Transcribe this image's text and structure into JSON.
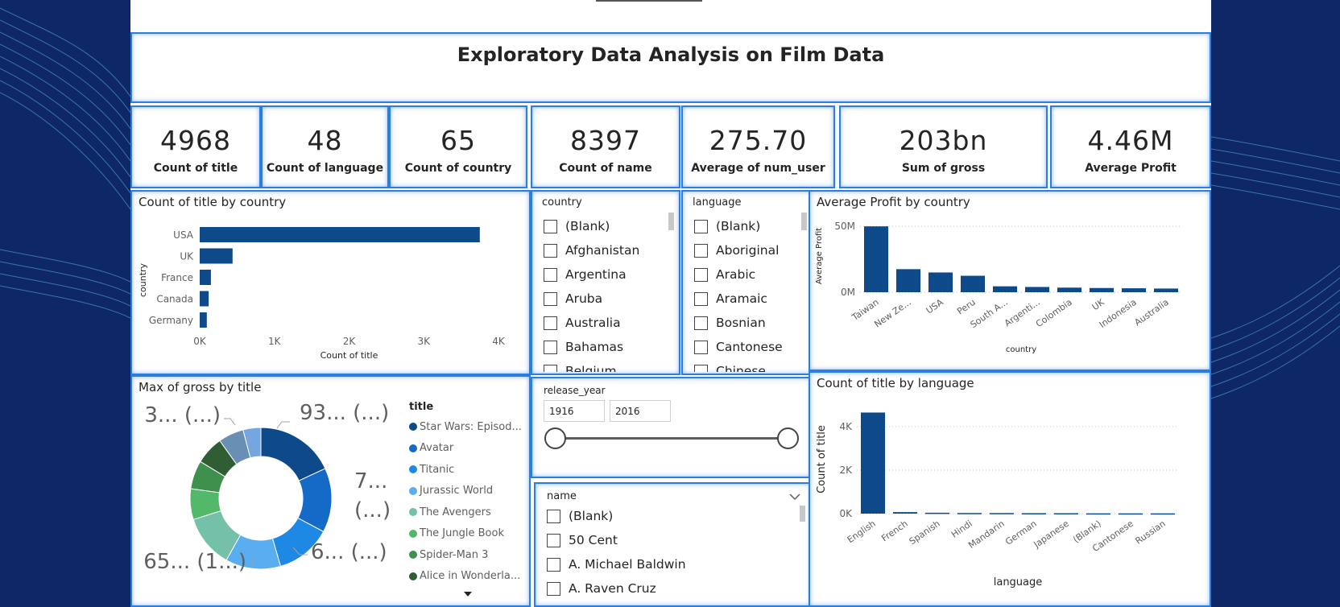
{
  "report": {
    "title": "Exploratory Data Analysis on Film Data"
  },
  "kpis": [
    {
      "value": "4968",
      "label": "Count of title"
    },
    {
      "value": "48",
      "label": "Count of language"
    },
    {
      "value": "65",
      "label": "Count of country"
    },
    {
      "value": "8397",
      "label": "Count of name"
    },
    {
      "value": "275.70",
      "label": "Average of num_user"
    },
    {
      "value": "203bn",
      "label": "Sum of gross"
    },
    {
      "value": "4.46M",
      "label": "Average Profit"
    }
  ],
  "slicers": {
    "country": {
      "header": "country",
      "items": [
        "(Blank)",
        "Afghanistan",
        "Argentina",
        "Aruba",
        "Australia",
        "Bahamas",
        "Belgium"
      ]
    },
    "language": {
      "header": "language",
      "items": [
        "(Blank)",
        "Aboriginal",
        "Arabic",
        "Aramaic",
        "Bosnian",
        "Cantonese",
        "Chinese"
      ]
    },
    "release_year": {
      "header": "release_year",
      "min": "1916",
      "max": "2016"
    },
    "name": {
      "header": "name",
      "items": [
        "(Blank)",
        "50 Cent",
        "A. Michael Baldwin",
        "A. Raven Cruz"
      ]
    }
  },
  "colors": {
    "primary": "#0e4a8a",
    "panel_border": "#2a7de1",
    "background": "#0f2a6b"
  },
  "chart_data": [
    {
      "id": "title_by_country",
      "type": "bar",
      "orientation": "horizontal",
      "title": "Count of title by country",
      "xlabel": "Count of title",
      "ylabel": "country",
      "categories": [
        "USA",
        "UK",
        "France",
        "Canada",
        "Germany"
      ],
      "values": [
        3750,
        440,
        150,
        120,
        95
      ],
      "xlim": [
        0,
        4000
      ],
      "xticks": [
        "0K",
        "1K",
        "2K",
        "3K",
        "4K"
      ],
      "grid": false,
      "color": "#0e4a8a"
    },
    {
      "id": "profit_by_country",
      "type": "bar",
      "title": "Average Profit by country",
      "xlabel": "country",
      "ylabel": "Average Profit",
      "categories": [
        "Taiwan",
        "New Ze...",
        "USA",
        "Peru",
        "South A...",
        "Argenti...",
        "Colombia",
        "UK",
        "Indonesia",
        "Australia"
      ],
      "values": [
        50,
        17.5,
        15,
        12.5,
        4.5,
        4,
        3.5,
        3.2,
        3,
        2.8
      ],
      "unit": "M",
      "ylim": [
        0,
        55
      ],
      "yticks": [
        "0M",
        "50M"
      ],
      "grid": true,
      "color": "#0e4a8a"
    },
    {
      "id": "gross_by_title",
      "type": "pie",
      "donut": true,
      "title": "Max of gross by title",
      "legend_title": "title",
      "legend_position": "right",
      "categories": [
        "Star Wars: Episod...",
        "Avatar",
        "Titanic",
        "Jurassic World",
        "The Avengers",
        "The Jungle Book",
        "Spider-Man 3",
        "Alice in Wonderla..."
      ],
      "values": [
        936,
        760,
        658,
        652,
        623,
        363,
        336,
        334
      ],
      "slice_colors": [
        "#0e4a8a",
        "#1569c7",
        "#1e88e5",
        "#5aaef0",
        "#75c0a8",
        "#52b96a",
        "#3f8f4d",
        "#2f5d34",
        "#6a8fb5",
        "#76a6e0"
      ],
      "extra_values": [
        300,
        210
      ],
      "data_labels": [
        "93... (...)",
        "7... (...)",
        "6... (...)",
        "65... (1...)",
        "3... (...)"
      ]
    },
    {
      "id": "title_by_language",
      "type": "bar",
      "title": "Count of title by language",
      "xlabel": "language",
      "ylabel": "Count of title",
      "categories": [
        "English",
        "French",
        "Spanish",
        "Hindi",
        "Mandarin",
        "German",
        "Japanese",
        "(Blank)",
        "Cantonese",
        "Russian"
      ],
      "values": [
        4650,
        70,
        40,
        28,
        26,
        19,
        18,
        12,
        11,
        11
      ],
      "ylim": [
        0,
        5000
      ],
      "yticks": [
        "0K",
        "2K",
        "4K"
      ],
      "grid": true,
      "color": "#0e4a8a"
    }
  ]
}
